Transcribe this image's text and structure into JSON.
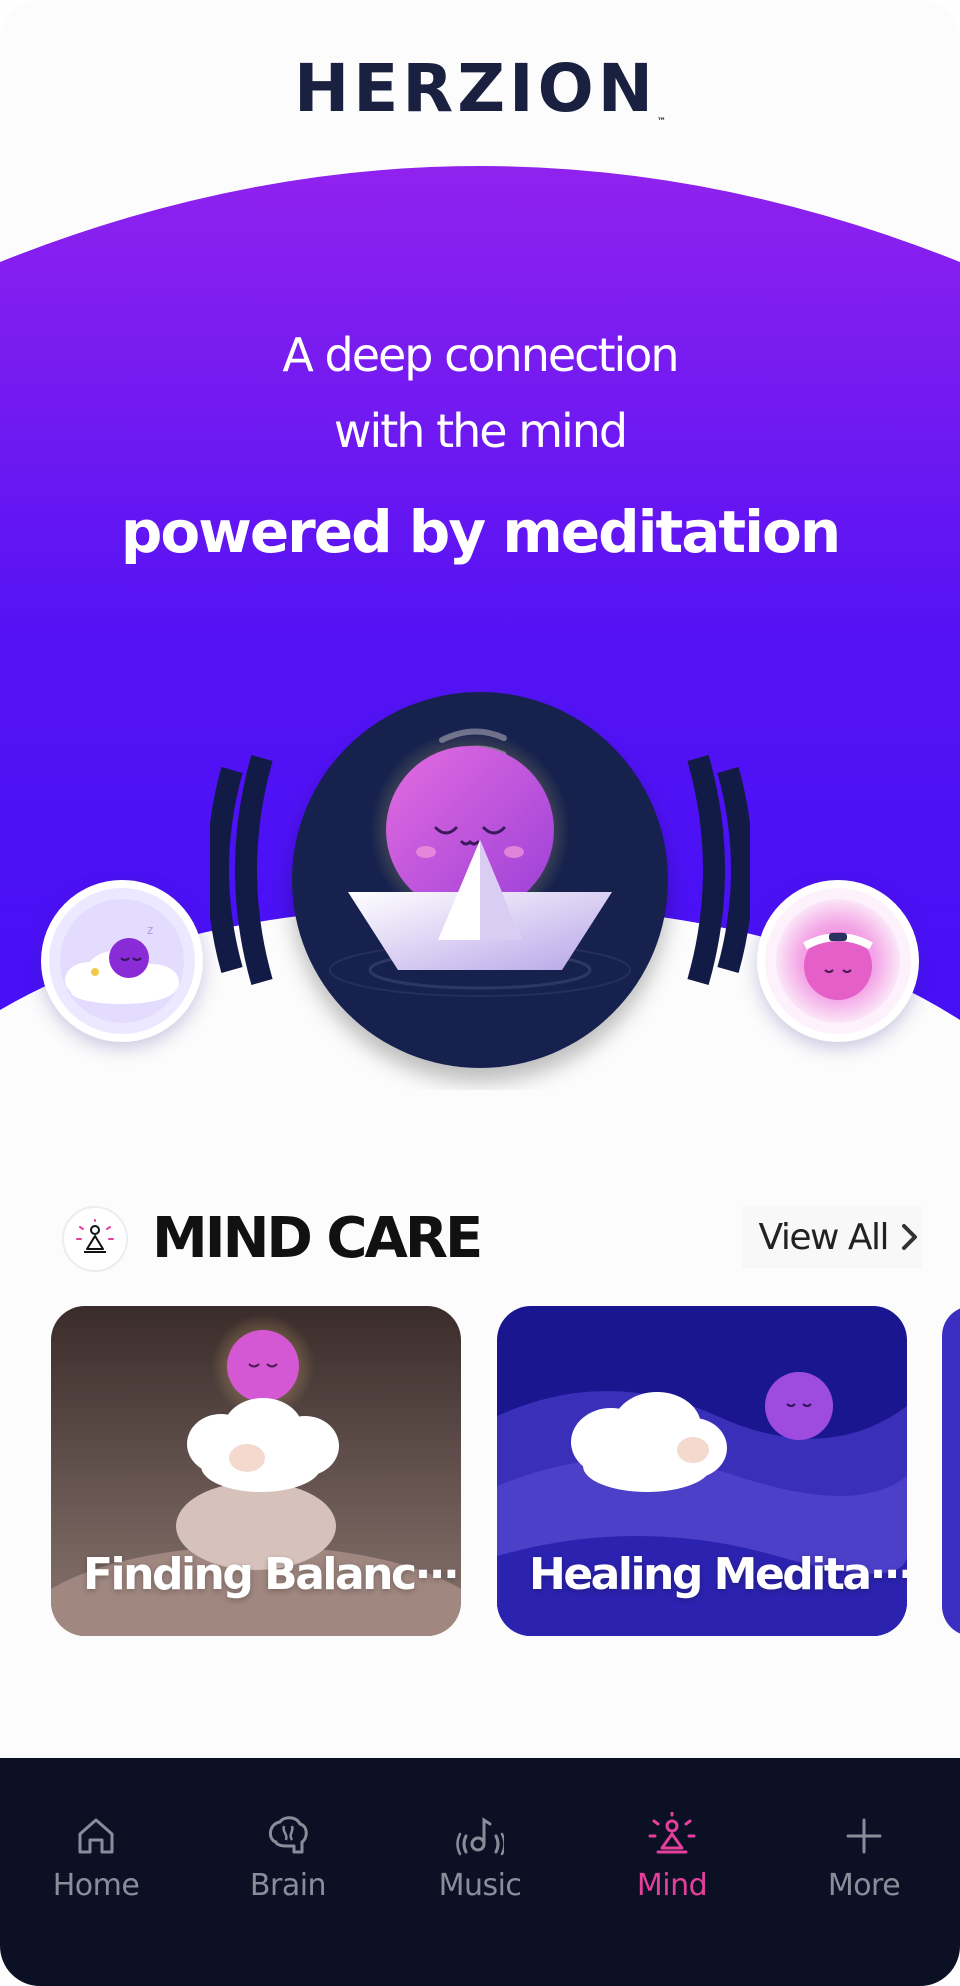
{
  "app": {
    "brand": "HERZION",
    "trademark": "™"
  },
  "hero": {
    "line1": "A deep connection",
    "line2": "with the mind",
    "line3": "powered by meditation"
  },
  "carousel": {
    "items": [
      "sleeping-character",
      "boat-meditation-character",
      "headband-character"
    ]
  },
  "mind_care": {
    "title": "MIND CARE",
    "view_all": "View All",
    "cards": [
      {
        "title": "Finding Balanc···"
      },
      {
        "title": "Healing Medita···"
      }
    ]
  },
  "tabbar": {
    "active": "Mind",
    "tabs": [
      {
        "label": "Home",
        "icon": "home-icon"
      },
      {
        "label": "Brain",
        "icon": "brain-icon"
      },
      {
        "label": "Music",
        "icon": "music-icon"
      },
      {
        "label": "Mind",
        "icon": "meditation-icon"
      },
      {
        "label": "More",
        "icon": "plus-icon"
      }
    ]
  },
  "colors": {
    "hero_top": "#8f22f0",
    "hero_bottom": "#4a10f5",
    "navy": "#17214d",
    "tab_bg": "#0c1024",
    "active_tab": "#e43f9a",
    "inactive_tab": "#8a8d99"
  }
}
